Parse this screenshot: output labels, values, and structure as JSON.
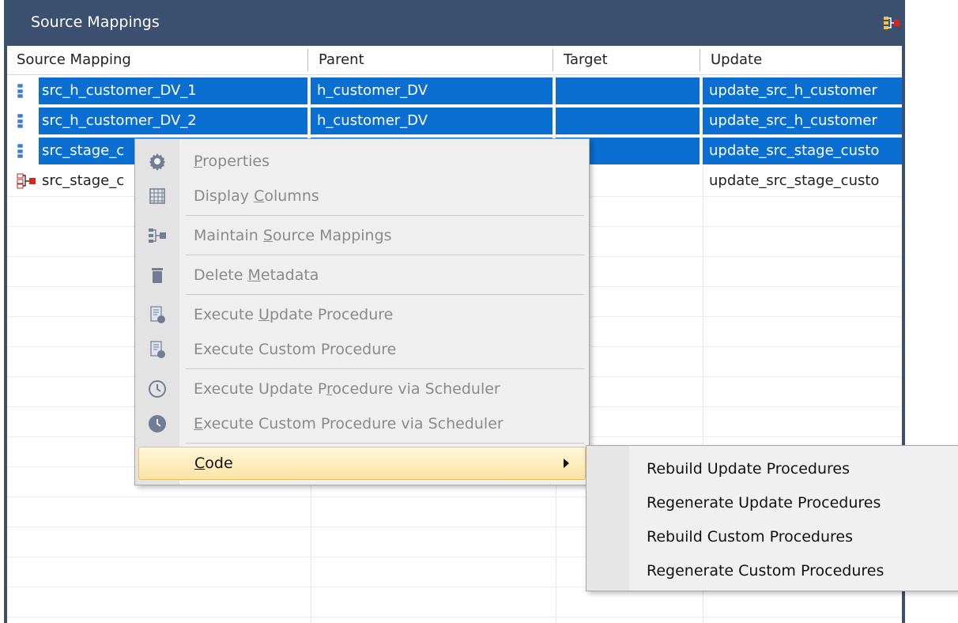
{
  "window": {
    "title": "Source Mappings",
    "title_icon": "source-mapping-icon"
  },
  "table": {
    "columns": [
      "Source Mapping",
      "Parent",
      "Target",
      "Update"
    ],
    "rows": [
      {
        "source_mapping": "src_h_customer_DV_1",
        "parent": "h_customer_DV",
        "target": "",
        "update": "update_src_h_customer",
        "selected": true
      },
      {
        "source_mapping": "src_h_customer_DV_2",
        "parent": "h_customer_DV",
        "target": "",
        "update": "update_src_h_customer",
        "selected": true
      },
      {
        "source_mapping": "src_stage_c",
        "parent": "",
        "target": "",
        "update": "update_src_stage_custo",
        "selected": true
      },
      {
        "source_mapping": "src_stage_c",
        "parent": "",
        "target": "",
        "update": "update_src_stage_custo",
        "selected": false
      }
    ]
  },
  "context_menu": {
    "items": [
      {
        "pre": "",
        "key": "P",
        "post": "roperties",
        "icon": "gear-icon",
        "enabled": false
      },
      {
        "pre": "Display ",
        "key": "C",
        "post": "olumns",
        "icon": "grid-icon",
        "enabled": false
      },
      {
        "pre": "Maintain ",
        "key": "S",
        "post": "ource Mappings",
        "icon": "source-mapping-icon",
        "enabled": false
      },
      {
        "pre": "Delete ",
        "key": "M",
        "post": "etadata",
        "icon": "trash-icon",
        "enabled": false
      },
      {
        "pre": "Execute ",
        "key": "U",
        "post": "pdate Procedure",
        "icon": "procedure-icon",
        "enabled": false
      },
      {
        "pre": "Execute Custom Procedure",
        "key": "",
        "post": "",
        "icon": "procedure-icon",
        "enabled": false
      },
      {
        "pre": "Execute Update P",
        "key": "r",
        "post": "ocedure via Scheduler",
        "icon": "clock-icon",
        "enabled": false
      },
      {
        "pre": "",
        "key": "E",
        "post": "xecute Custom Procedure via Scheduler",
        "icon": "clock-filled-icon",
        "enabled": false
      }
    ],
    "code": {
      "key": "C",
      "post": "ode"
    }
  },
  "submenu": {
    "items": [
      "Rebuild Update Procedures",
      "Regenerate Update Procedures",
      "Rebuild Custom Procedures",
      "Regenerate Custom Procedures"
    ]
  },
  "colors": {
    "titlebar": "#3c506f",
    "selection": "#0a6fd0",
    "menu_highlight": "#fbe3a4"
  }
}
